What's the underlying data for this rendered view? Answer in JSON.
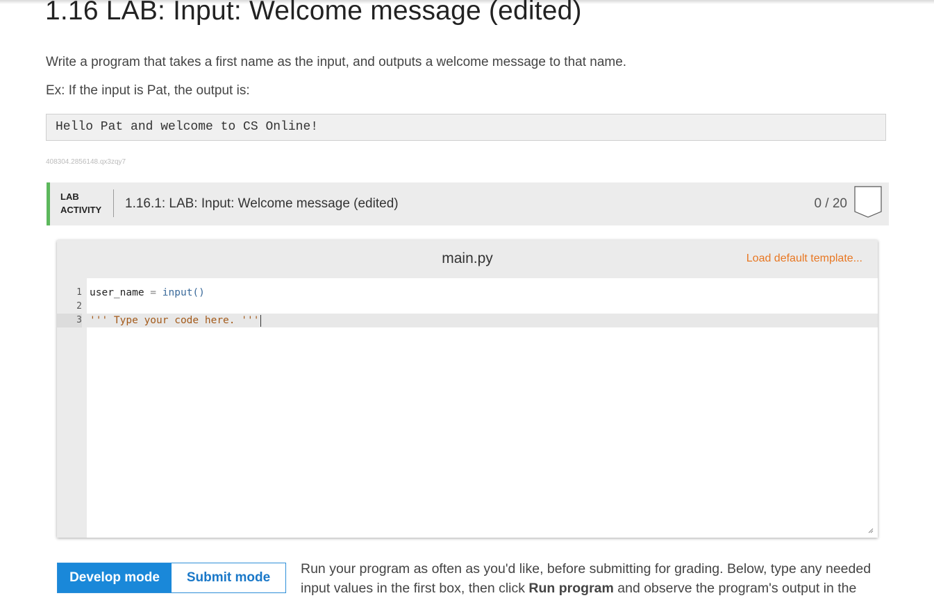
{
  "page": {
    "title": "1.16 LAB: Input: Welcome message (edited)",
    "description": "Write a program that takes a first name as the input, and outputs a welcome message to that name.",
    "example_intro": "Ex: If the input is Pat, the output is:",
    "example_output": "Hello Pat and welcome to CS Online!",
    "id_tag": "408304.2856148.qx3zqy7"
  },
  "lab": {
    "label_line1": "LAB",
    "label_line2": "ACTIVITY",
    "title": "1.16.1: LAB: Input: Welcome message (edited)",
    "score": "0 / 20",
    "accent_color": "#5cb85c"
  },
  "editor": {
    "filename": "main.py",
    "load_template_label": "Load default template...",
    "lines": [
      {
        "num": "1",
        "var": "user_name",
        "op": " = ",
        "func": "input()"
      },
      {
        "num": "2"
      },
      {
        "num": "3",
        "string": "''' Type your code here. '''"
      }
    ]
  },
  "modes": {
    "develop_label": "Develop mode",
    "submit_label": "Submit mode"
  },
  "instructions": {
    "part1": "Run your program as often as you'd like, before submitting for grading. Below, type any needed input values in the first box, then click ",
    "bold": "Run program",
    "part2": " and observe the program's output in the"
  }
}
